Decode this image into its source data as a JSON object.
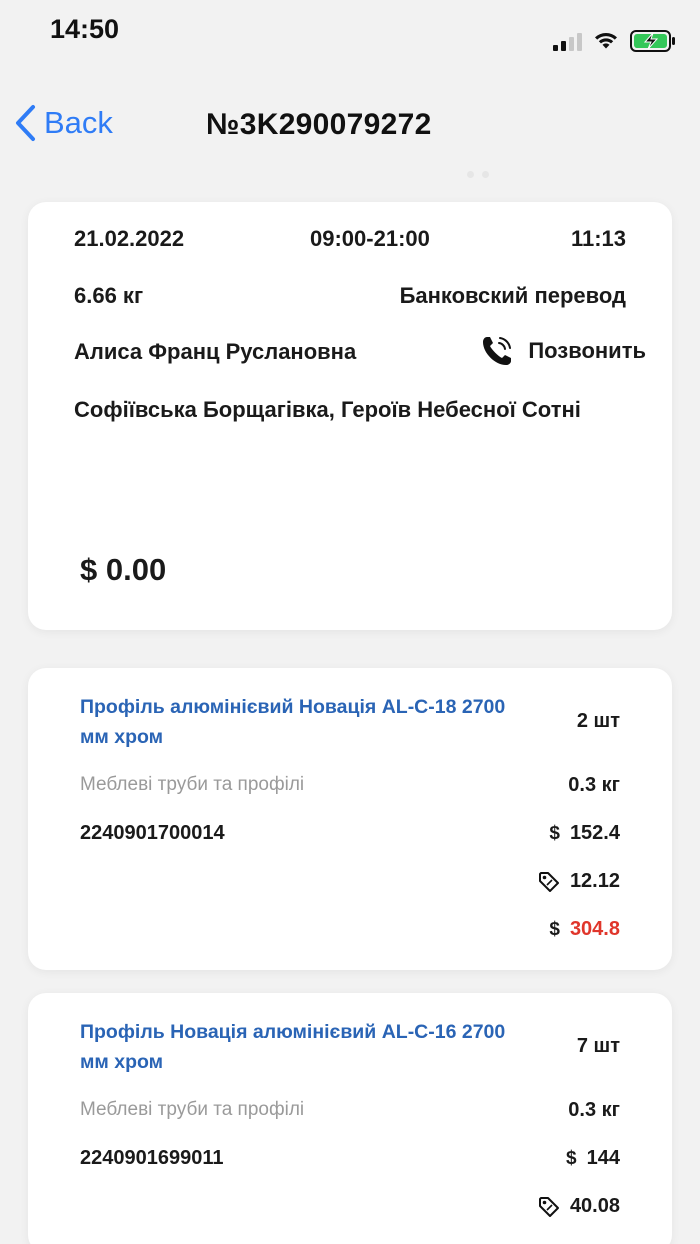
{
  "status": {
    "time": "14:50"
  },
  "nav": {
    "back_label": "Back",
    "order_number": "№3K290079272"
  },
  "summary": {
    "date": "21.02.2022",
    "window": "09:00-21:00",
    "time": "11:13",
    "weight": "6.66 кг",
    "payment": "Банковский перевод",
    "customer": "Алиса Франц Руслановна",
    "call_label": "Позвонить",
    "address": "Софіївська Борщагівка, Героїв Небесної Сотні",
    "currency": "$",
    "total": "0.00"
  },
  "items": [
    {
      "name": "Профіль алюмінієвий Новація AL-C-18 2700 мм хром",
      "qty": "2 шт",
      "category": "Меблеві труби та профілі",
      "weight": "0.3 кг",
      "barcode": "2240901700014",
      "currency": "$",
      "price": "152.4",
      "discount": "12.12",
      "sum": "304.8"
    },
    {
      "name": "Профіль Новація алюмінієвий AL-C-16 2700 мм хром",
      "qty": "7 шт",
      "category": "Меблеві труби та профілі",
      "weight": "0.3 кг",
      "barcode": "2240901699011",
      "currency": "$",
      "price": "144",
      "discount": "40.08"
    }
  ],
  "colors": {
    "accent": "#2f7cf6",
    "link": "#2a64b5",
    "sum": "#e0362b",
    "battery": "#34c759"
  }
}
